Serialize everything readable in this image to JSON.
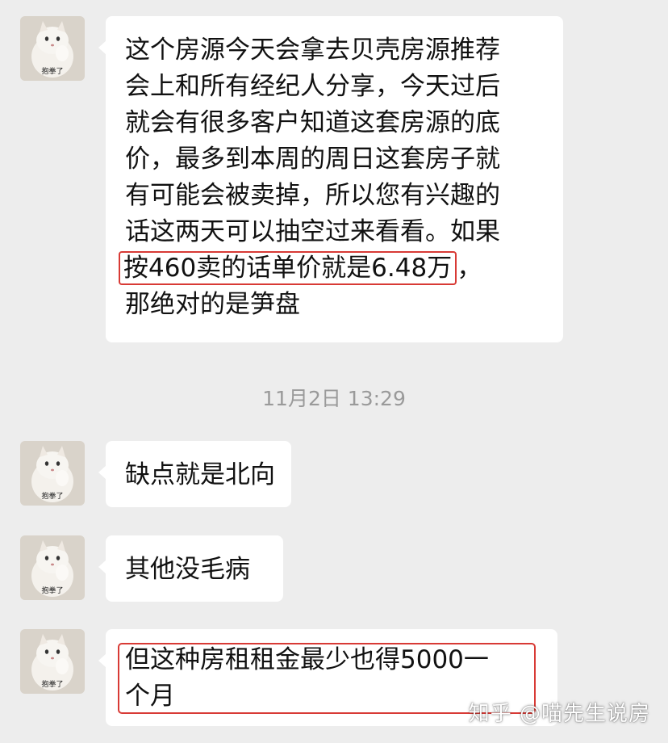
{
  "messages": [
    {
      "avatar_caption": "抱拳了",
      "lines": [
        "这个房源今天会拿去贝壳房源推荐",
        "会上和所有经纪人分享，今天过后",
        "就会有很多客户知道这套房源的底",
        "价，最多到本周的周日这套房子就",
        "有可能会被卖掉，所以您有兴趣的",
        "话这两天可以抽空过来看看。如果"
      ],
      "highlight_text": "按460卖的话单价就是6.48万",
      "highlight_tail": "，",
      "last_line": "那绝对的是笋盘"
    },
    {
      "avatar_caption": "抱拳了",
      "text": "缺点就是北向"
    },
    {
      "avatar_caption": "抱拳了",
      "text": "其他没毛病"
    },
    {
      "avatar_caption": "抱拳了",
      "lines": [
        "但这种房租租金最少也得5000一",
        "个月"
      ]
    }
  ],
  "timestamp": "11月2日 13:29",
  "watermark": "知乎 @喵先生说房",
  "colors": {
    "background": "#ededed",
    "bubble": "#ffffff",
    "highlight": "#d83a35"
  }
}
